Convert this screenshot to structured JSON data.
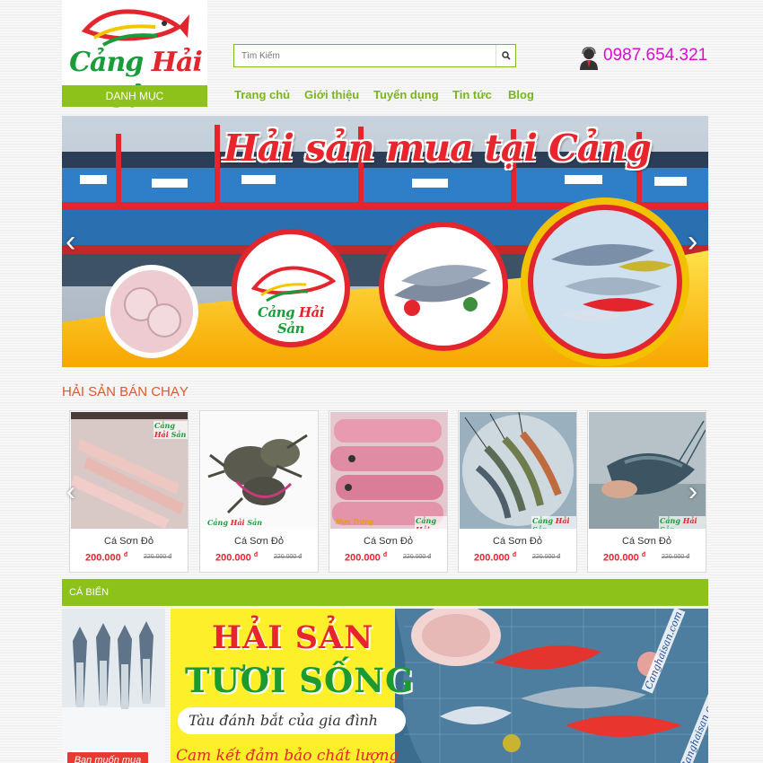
{
  "header": {
    "logo": {
      "part1": "Cảng",
      "part2": "Hải",
      "part3": "Sản"
    },
    "category_button": "DANH MỤC",
    "search": {
      "placeholder": "Tìm Kiếm",
      "icon": "search-icon"
    },
    "hotline": {
      "number": "0987.654.321",
      "icon": "user-support-icon",
      "color": "#e00ad4"
    },
    "nav": [
      "Trang chủ",
      "Giới thiệu",
      "Tuyển dụng",
      "Tin tức",
      "Blog"
    ]
  },
  "banner": {
    "headline": "Hải sản mua tại Cảng",
    "logo": {
      "part1": "Cảng",
      "part2": "Hải",
      "part3": "Sản"
    },
    "prev": "‹",
    "next": "›"
  },
  "bestsellers": {
    "title": "HẢI SẢN BÁN CHẠY",
    "prev": "‹",
    "next": "›",
    "items": [
      {
        "name": "Cá Sơn Đỏ",
        "price": "200.000",
        "currency": "đ",
        "old_price": "220.000 đ"
      },
      {
        "name": "Cá Sơn Đỏ",
        "price": "200.000",
        "currency": "đ",
        "old_price": "220.000 đ"
      },
      {
        "name": "Cá Sơn Đỏ",
        "price": "200.000",
        "currency": "đ",
        "old_price": "220.000 đ"
      },
      {
        "name": "Cá Sơn Đỏ",
        "price": "200.000",
        "currency": "đ",
        "old_price": "220.000 đ"
      },
      {
        "name": "Cá Sơn Đỏ",
        "price": "200.000",
        "currency": "đ",
        "old_price": "220.000 đ"
      }
    ],
    "watermark": {
      "part1": "Cảng",
      "part2": "Hải",
      "part3": "Sản"
    },
    "squid_label": "Mực Trứng"
  },
  "category": {
    "title": "CÁ BIỂN",
    "side_tag": "Ban muốn mua",
    "promo": {
      "line1": "HẢI SẢN",
      "line2": "TƯƠI SỐNG",
      "line3": "Tàu đánh bắt của gia đình",
      "line4": "Cam kết đảm bảo chất lượng",
      "site": "Canghaisan.com"
    }
  },
  "colors": {
    "accent_green": "#8cc21a",
    "nav_green": "#7ab51d",
    "section_orange": "#e8552a",
    "price_red": "#e8242d"
  }
}
